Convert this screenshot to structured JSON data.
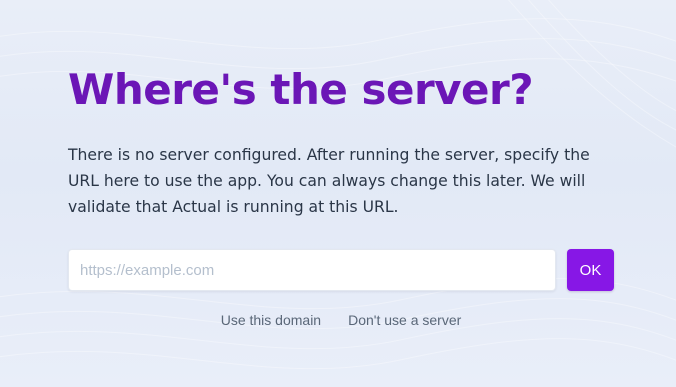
{
  "page": {
    "title": "Where's the server?",
    "description": "There is no server configured. After running the server, specify the URL here to use the app. You can always change this later. We will validate that Actual is running at this URL."
  },
  "form": {
    "url_value": "",
    "url_placeholder": "https://example.com",
    "ok_label": "OK"
  },
  "links": {
    "use_domain": "Use this domain",
    "no_server": "Don't use a server"
  },
  "colors": {
    "title": "#6b16b6",
    "accent_button": "#8717e6",
    "background": "#e6ecf7",
    "body_text": "#2a3647",
    "link_text": "#5a6778"
  }
}
